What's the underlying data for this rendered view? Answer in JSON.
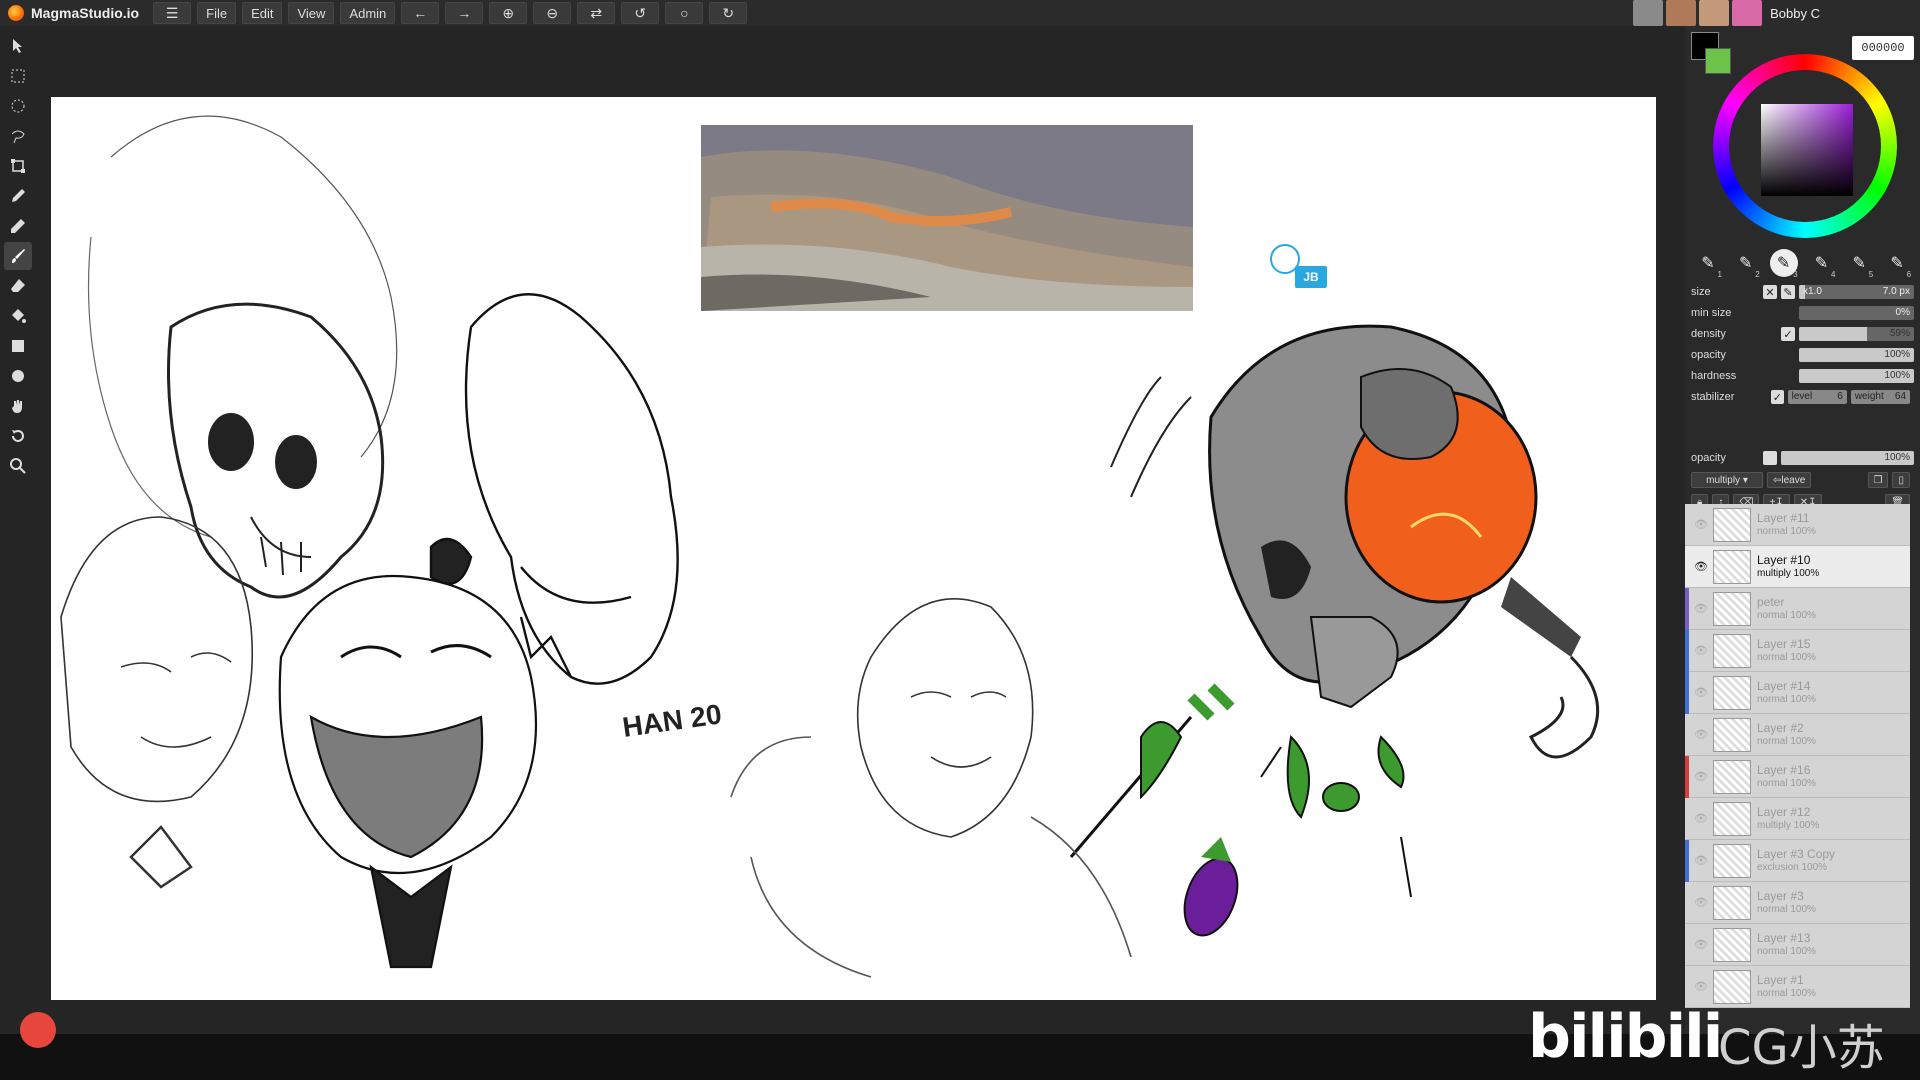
{
  "app": {
    "name": "MagmaStudio.io",
    "menus": [
      "File",
      "Edit",
      "View",
      "Admin"
    ],
    "user_name": "Bobby C"
  },
  "canvas": {
    "cursor_tag": "JB",
    "signature_text": "HAN 20"
  },
  "color": {
    "hex": "000000",
    "foreground": "#000000",
    "background": "#6dc24a"
  },
  "brush_slots": [
    "1",
    "2",
    "3",
    "4",
    "5",
    "6"
  ],
  "brush_props": {
    "size": {
      "label": "size",
      "multiplier": "x1.0",
      "value": "7.0 px",
      "fill": 0.05
    },
    "min_size": {
      "label": "min size",
      "value": "0%",
      "fill": 0
    },
    "density": {
      "label": "density",
      "value": "59%",
      "fill": 0.59
    },
    "opacity": {
      "label": "opacity",
      "value": "100%",
      "fill": 1.0
    },
    "hardness": {
      "label": "hardness",
      "value": "100%",
      "fill": 1.0
    },
    "stabilizer": {
      "label": "stabilizer",
      "level_label": "level",
      "level": "6",
      "weight_label": "weight",
      "weight": "64"
    }
  },
  "layer_props": {
    "opacity_label": "opacity",
    "opacity_value": "100%",
    "blend_mode": "multiply",
    "leave_label": "leave"
  },
  "layers": [
    {
      "name": "Layer #11",
      "mode": "normal 100%",
      "active": false,
      "color": ""
    },
    {
      "name": "Layer #10",
      "mode": "multiply 100%",
      "active": true,
      "color": ""
    },
    {
      "name": "peter",
      "mode": "normal 100%",
      "active": false,
      "color": "#7a5cc7"
    },
    {
      "name": "Layer #15",
      "mode": "normal 100%",
      "active": false,
      "color": "#3f6fd8"
    },
    {
      "name": "Layer #14",
      "mode": "normal 100%",
      "active": false,
      "color": "#3f6fd8"
    },
    {
      "name": "Layer #2",
      "mode": "normal 100%",
      "active": false,
      "color": ""
    },
    {
      "name": "Layer #16",
      "mode": "normal 100%",
      "active": false,
      "color": "#d83b3b"
    },
    {
      "name": "Layer #12",
      "mode": "multiply 100%",
      "active": false,
      "color": ""
    },
    {
      "name": "Layer #3 Copy",
      "mode": "exclusion 100%",
      "active": false,
      "color": "#3f6fd8"
    },
    {
      "name": "Layer #3",
      "mode": "normal 100%",
      "active": false,
      "color": ""
    },
    {
      "name": "Layer #13",
      "mode": "normal 100%",
      "active": false,
      "color": ""
    },
    {
      "name": "Layer #1",
      "mode": "normal 100%",
      "active": false,
      "color": ""
    }
  ],
  "watermark": {
    "brand": "bilibili",
    "channel": "CG小苏"
  }
}
